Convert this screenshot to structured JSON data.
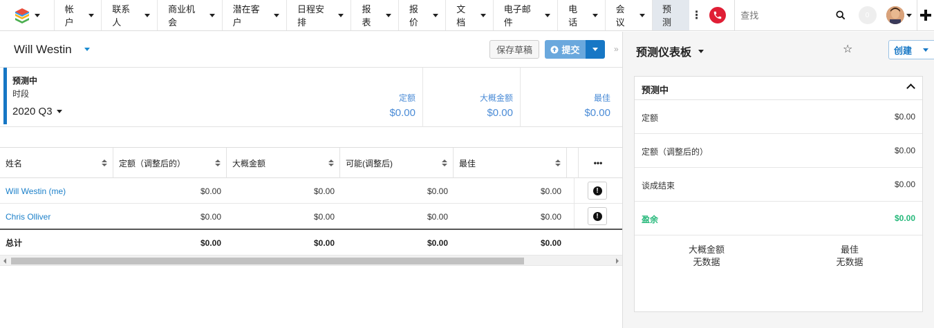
{
  "topnav": {
    "items": [
      {
        "label": "帐户"
      },
      {
        "label": "联系人"
      },
      {
        "label": "商业机会"
      },
      {
        "label": "潜在客户"
      },
      {
        "label": "日程安排"
      },
      {
        "label": "报表"
      },
      {
        "label": "报价"
      },
      {
        "label": "文档"
      },
      {
        "label": "电子邮件"
      },
      {
        "label": "电话"
      },
      {
        "label": "会议"
      }
    ],
    "active_item": "预测",
    "more_label": "⋮",
    "search_placeholder": "查找",
    "notification_count": "0",
    "accent_phone": "#e01e35"
  },
  "record": {
    "title": "Will Westin",
    "save_draft_label": "保存草稿",
    "submit_label": "提交"
  },
  "summary": {
    "label": "预测中",
    "period_label": "时段",
    "period": "2020 Q3",
    "cols": [
      {
        "label": "定额",
        "value": "$0.00"
      },
      {
        "label": "大概金额",
        "value": "$0.00"
      },
      {
        "label": "最佳",
        "value": "$0.00"
      }
    ]
  },
  "table": {
    "headers": [
      "姓名",
      "定额（调整后的）",
      "大概金额",
      "可能(调整后)",
      "最佳"
    ],
    "actions_header": "•••",
    "rows": [
      {
        "name": "Will Westin (me)",
        "values": [
          "$0.00",
          "$0.00",
          "$0.00",
          "$0.00"
        ]
      },
      {
        "name": "Chris Olliver",
        "values": [
          "$0.00",
          "$0.00",
          "$0.00",
          "$0.00"
        ]
      }
    ],
    "total": {
      "label": "总计",
      "values": [
        "$0.00",
        "$0.00",
        "$0.00",
        "$0.00"
      ]
    }
  },
  "dashboard": {
    "title": "预测仪表板",
    "create_label": "创建",
    "card_title": "预测中",
    "rows": [
      {
        "label": "定额",
        "value": "$0.00"
      },
      {
        "label": "定额（调整后的）",
        "value": "$0.00"
      },
      {
        "label": "谈成结束",
        "value": "$0.00"
      },
      {
        "label": "盈余",
        "value": "$0.00"
      }
    ],
    "nodata": [
      {
        "label": "大概金额",
        "text": "无数据"
      },
      {
        "label": "最佳",
        "text": "无数据"
      }
    ],
    "accent_surplus": "#25b87a"
  }
}
